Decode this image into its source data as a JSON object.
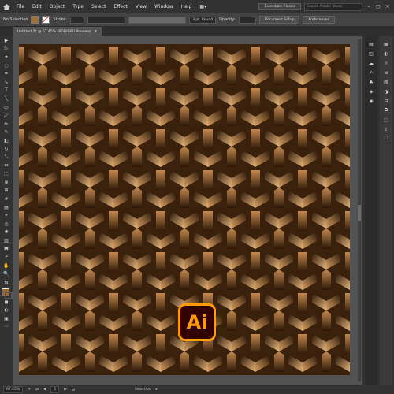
{
  "menubar": {
    "items": [
      "File",
      "Edit",
      "Object",
      "Type",
      "Select",
      "Effect",
      "View",
      "Window",
      "Help"
    ],
    "workspace": "Essentials Classic",
    "search_placeholder": "Search Adobe Stock"
  },
  "controlbar": {
    "selection_label": "No Selection",
    "stroke_label": "Stroke:",
    "brush_value": "3 pt. Round",
    "opacity_label": "Opacity:",
    "document_setup": "Document Setup",
    "preferences": "Preferences"
  },
  "tab": {
    "title": "Untitled-2* @ 67.45% (RGB/GPU Preview)"
  },
  "statusbar": {
    "zoom": "67.45%",
    "artboard_number": "1",
    "tool_name": "Selection"
  },
  "logo": {
    "text": "Ai"
  },
  "colors": {
    "accent": "#ff9a00",
    "pattern_dark": "#2a1607",
    "pattern_light": "#e8b77b"
  }
}
